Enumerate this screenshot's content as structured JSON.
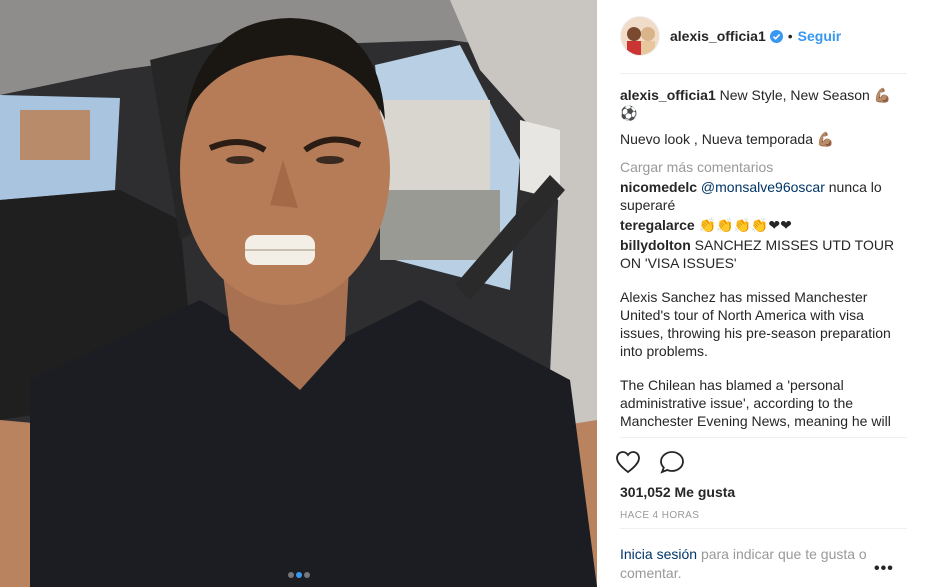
{
  "photo": {
    "alt": "",
    "carousel_count": 3,
    "carousel_active": 2
  },
  "header": {
    "username": "alexis_officia1",
    "separator": "•",
    "follow_label": "Seguir"
  },
  "caption": {
    "username": "alexis_officia1",
    "line1": "New Style, New Season 💪🏽⚽",
    "line2": "Nuevo look , Nueva temporada 💪🏽"
  },
  "load_more": "Cargar más comentarios",
  "comments": [
    {
      "username": "nicomedelc",
      "mention": "@monsalve96oscar",
      "text": "nunca lo superaré"
    },
    {
      "username": "teregalarce",
      "text": "👏👏👏👏❤❤"
    },
    {
      "username": "billydolton",
      "text": "SANCHEZ MISSES UTD TOUR ON 'VISA ISSUES'",
      "paragraphs": [
        "Alexis Sanchez has missed Manchester United's tour of North America with visa issues, throwing his pre-season preparation into problems.",
        "The Chilean has blamed a 'personal administrative issue', according to the Manchester Evening News, meaning he will"
      ]
    }
  ],
  "likes": "301,052 Me gusta",
  "timestamp": "HACE 4 HORAS",
  "login_prompt": {
    "link": "Inicia sesión",
    "rest": "para indicar que te gusta o comentar."
  },
  "more_options": "•••",
  "icons": {
    "like": "heart-icon",
    "comment": "comment-icon",
    "verified": "verified-badge-icon",
    "more": "more-options-icon"
  },
  "colors": {
    "accent": "#3897f0",
    "link": "#003569",
    "muted": "#999999",
    "text": "#262626"
  }
}
